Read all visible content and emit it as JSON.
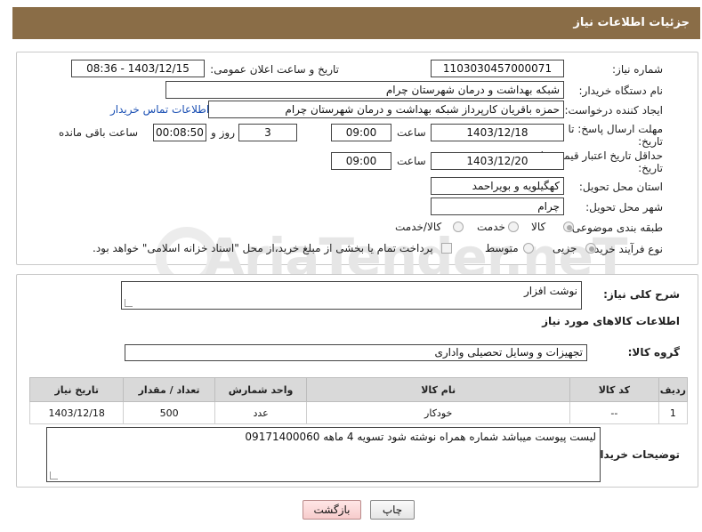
{
  "header": {
    "title": "جزئیات اطلاعات نیاز"
  },
  "need_info": {
    "need_number_label": "شماره نیاز:",
    "need_number": "1103030457000071",
    "announce_label": "تاریخ و ساعت اعلان عمومی:",
    "announce_value": "1403/12/15 - 08:36",
    "buyer_org_label": "نام دستگاه خریدار:",
    "buyer_org": "شبکه بهداشت و درمان شهرستان چرام",
    "creator_label": "ایجاد کننده درخواست:",
    "creator": "حمزه باقریان کارپرداز شبکه بهداشت و درمان شهرستان چرام",
    "contact_link": "اطلاعات تماس خریدار",
    "deadline_label_1": "مهلت ارسال پاسخ: تا",
    "deadline_label_2": "تاریخ:",
    "deadline_date": "1403/12/18",
    "time_label": "ساعت",
    "deadline_time": "09:00",
    "days_value": "3",
    "days_label": "روز و",
    "remaining_time": "00:08:50",
    "remaining_label": "ساعت باقی مانده",
    "price_validity_label_1": "حداقل تاریخ اعتبار قیمت: تا",
    "price_validity_label_2": "تاریخ:",
    "price_validity_date": "1403/12/20",
    "price_validity_time": "09:00",
    "province_label": "استان محل تحویل:",
    "province": "کهگیلویه و بویراحمد",
    "city_label": "شهر محل تحویل:",
    "city": "چرام",
    "category_label": "طبقه بندی موضوعی:",
    "category_options": [
      "کالا",
      "خدمت",
      "کالا/خدمت"
    ],
    "category_selected": "کالا",
    "process_label": "نوع فرآیند خرید :",
    "process_options": [
      "جزیی",
      "متوسط"
    ],
    "process_selected": "جزیی",
    "payment_note": "پرداخت تمام یا بخشی از مبلغ خرید،از محل \"اسناد خزانه اسلامی\" خواهد بود."
  },
  "description": {
    "label": "شرح کلی نیاز:",
    "value": "نوشت افزار",
    "goods_info_title": "اطلاعات کالاهای مورد نیاز",
    "group_label": "گروه کالا:",
    "group_value": "تجهیزات و وسایل تحصیلی واداری"
  },
  "items_table": {
    "headers": [
      "ردیف",
      "کد کالا",
      "نام کالا",
      "واحد شمارش",
      "تعداد / مقدار",
      "تاریخ نیاز"
    ],
    "rows": [
      [
        "1",
        "--",
        "خودکار",
        "عدد",
        "500",
        "1403/12/18"
      ]
    ]
  },
  "buyer_notes": {
    "label": "توضیحات خریدار:",
    "value": "لیست پیوست میباشد شماره همراه نوشته شود تسویه 4 ماهه 09171400060"
  },
  "buttons": {
    "print": "چاپ",
    "back": "بازگشت"
  },
  "watermark": {
    "text": "AriaTender.neT"
  }
}
